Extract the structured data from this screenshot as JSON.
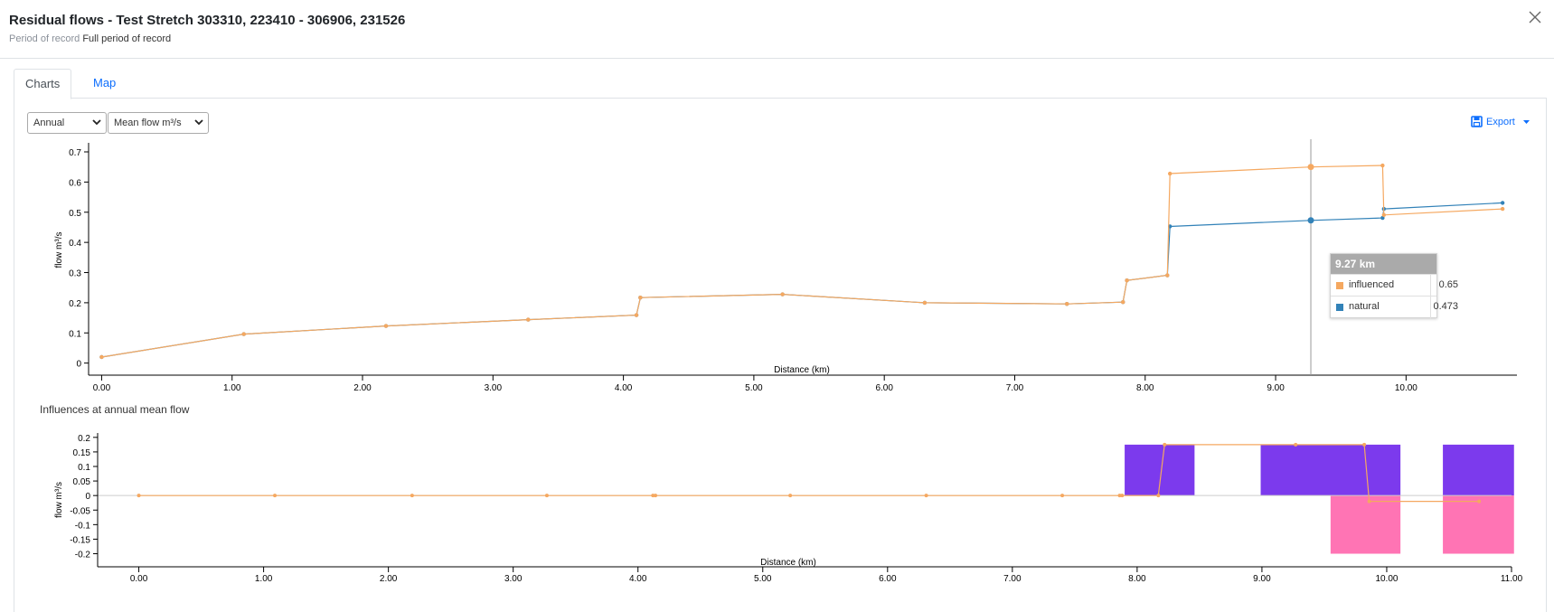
{
  "modal": {
    "title": "Residual flows - Test Stretch 303310, 223410 - 306906, 231526",
    "period_label": "Period of record",
    "period_value": "Full period of record",
    "close_icon": "close-icon"
  },
  "tabs": [
    {
      "label": "Charts",
      "active": true
    },
    {
      "label": "Map",
      "active": false
    }
  ],
  "controls": {
    "period_select": {
      "selected": "Annual"
    },
    "metric_select": {
      "selected": "Mean flow m³/s"
    },
    "export_label": "Export",
    "export_icon": "save-icon"
  },
  "colors": {
    "influenced": "#f5a860",
    "natural": "#3282b8",
    "positive_bar": "#7c3aed",
    "negative_bar": "#ff74b4"
  },
  "section_title": "Influences at annual mean flow",
  "tooltip": {
    "title": "9.27 km",
    "rows": [
      {
        "name": "influenced",
        "value": "0.65"
      },
      {
        "name": "natural",
        "value": "0.473"
      }
    ]
  },
  "chart_data": [
    {
      "type": "line",
      "xlabel": "Distance (km)",
      "ylabel": "flow m³/s",
      "xlim": [
        -0.1,
        10.85
      ],
      "ylim": [
        -0.04,
        0.73
      ],
      "xticks": [
        0,
        1,
        2,
        3,
        4,
        5,
        6,
        7,
        8,
        9,
        10
      ],
      "xtick_labels": [
        "0.00",
        "1.00",
        "2.00",
        "3.00",
        "4.00",
        "5.00",
        "6.00",
        "7.00",
        "8.00",
        "9.00",
        "10.00"
      ],
      "yticks": [
        0,
        0.1,
        0.2,
        0.3,
        0.4,
        0.5,
        0.6,
        0.7
      ],
      "ytick_labels": [
        "0",
        "0.1",
        "0.2",
        "0.3",
        "0.4",
        "0.5",
        "0.6",
        "0.7"
      ],
      "crosshair_x": 9.27,
      "series": [
        {
          "name": "influenced",
          "points": [
            [
              0,
              0.02
            ],
            [
              1.09,
              0.096
            ],
            [
              2.18,
              0.123
            ],
            [
              3.27,
              0.144
            ],
            [
              4.1,
              0.159
            ],
            [
              4.13,
              0.217
            ],
            [
              5.22,
              0.228
            ],
            [
              6.31,
              0.2
            ],
            [
              7.4,
              0.196
            ],
            [
              7.83,
              0.202
            ],
            [
              7.86,
              0.274
            ],
            [
              8.17,
              0.291
            ],
            [
              8.19,
              0.628
            ],
            [
              9.27,
              0.65
            ],
            [
              9.82,
              0.655
            ],
            [
              9.83,
              0.491
            ],
            [
              10.74,
              0.511
            ]
          ]
        },
        {
          "name": "natural",
          "points": [
            [
              0,
              0.02
            ],
            [
              1.09,
              0.096
            ],
            [
              2.18,
              0.123
            ],
            [
              3.27,
              0.144
            ],
            [
              4.1,
              0.159
            ],
            [
              4.13,
              0.217
            ],
            [
              5.22,
              0.228
            ],
            [
              6.31,
              0.2
            ],
            [
              7.4,
              0.196
            ],
            [
              7.83,
              0.202
            ],
            [
              7.86,
              0.274
            ],
            [
              8.17,
              0.291
            ],
            [
              8.19,
              0.453
            ],
            [
              9.27,
              0.473
            ],
            [
              9.82,
              0.481
            ],
            [
              9.83,
              0.511
            ],
            [
              10.74,
              0.531
            ]
          ]
        }
      ]
    },
    {
      "type": "bar",
      "title": "Influences at annual mean flow",
      "xlabel": "Distance (km)",
      "ylabel": "flow m³/s",
      "xlim": [
        -0.33,
        11.0
      ],
      "ylim": [
        -0.245,
        0.215
      ],
      "xticks": [
        0,
        1,
        2,
        3,
        4,
        5,
        6,
        7,
        8,
        9,
        10,
        11
      ],
      "xtick_labels": [
        "0.00",
        "1.00",
        "2.00",
        "3.00",
        "4.00",
        "5.00",
        "6.00",
        "7.00",
        "8.00",
        "9.00",
        "10.00",
        "11.00"
      ],
      "yticks": [
        0.2,
        0.15,
        0.1,
        0.05,
        0,
        -0.05,
        -0.1,
        -0.15,
        -0.2
      ],
      "ytick_labels": [
        "0.2",
        "0.15",
        "0.1",
        "0.05",
        "0",
        "-0.05",
        "-0.1",
        "-0.15",
        "-0.2"
      ],
      "bars": [
        {
          "x0": 7.9,
          "x1": 8.46,
          "value": 0.175
        },
        {
          "x0": 8.99,
          "x1": 10.11,
          "value": 0.175
        },
        {
          "x0": 9.55,
          "x1": 10.11,
          "value": -0.2
        },
        {
          "x0": 10.45,
          "x1": 11.02,
          "value": 0.175
        },
        {
          "x0": 10.45,
          "x1": 11.02,
          "value": -0.2
        }
      ],
      "line": [
        [
          0,
          0
        ],
        [
          1.09,
          0
        ],
        [
          2.19,
          0
        ],
        [
          3.27,
          0
        ],
        [
          4.12,
          0
        ],
        [
          4.14,
          0
        ],
        [
          5.22,
          0
        ],
        [
          6.31,
          0
        ],
        [
          7.4,
          0
        ],
        [
          7.86,
          0
        ],
        [
          7.88,
          0
        ],
        [
          8.17,
          0
        ],
        [
          8.22,
          0.175
        ],
        [
          9.27,
          0.175
        ],
        [
          9.82,
          0.175
        ],
        [
          9.86,
          -0.02
        ],
        [
          10.74,
          -0.02
        ]
      ]
    }
  ]
}
